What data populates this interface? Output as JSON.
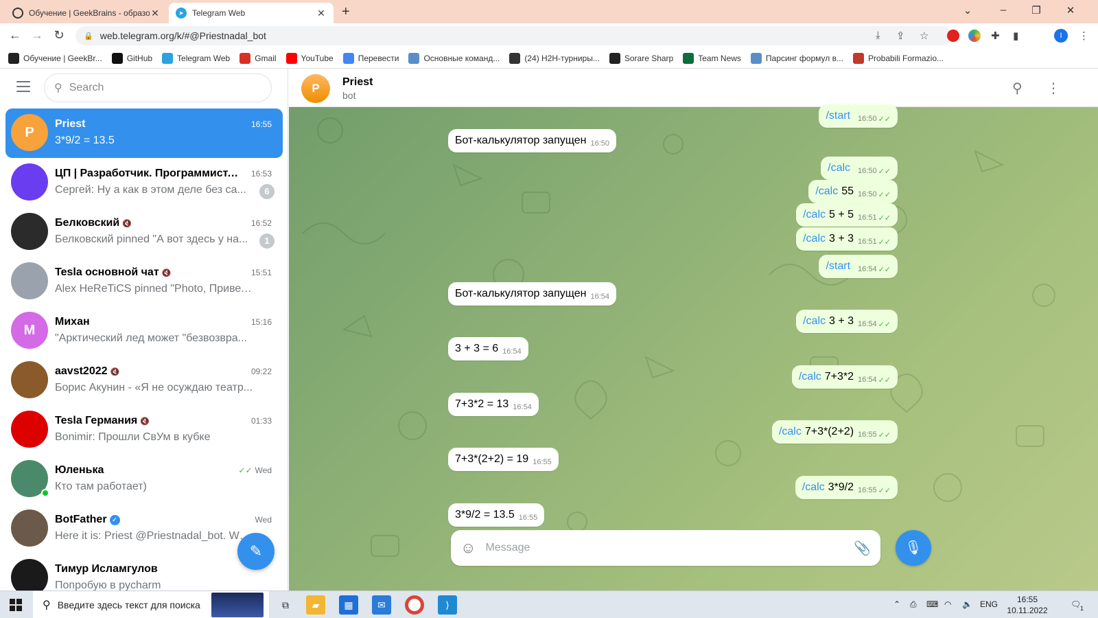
{
  "browser": {
    "tabs": [
      {
        "title": "Обучение | GeekBrains - образо",
        "active": false
      },
      {
        "title": "Telegram Web",
        "active": true
      }
    ],
    "url": "web.telegram.org/k/#@Priestnadal_bot",
    "bookmarks": [
      {
        "label": "Обучение | GeekBr...",
        "icon": "geekbrains-icon",
        "color": "#222222"
      },
      {
        "label": "GitHub",
        "icon": "github-icon",
        "color": "#111111"
      },
      {
        "label": "Telegram Web",
        "icon": "telegram-icon",
        "color": "#2aa3e0"
      },
      {
        "label": "Gmail",
        "icon": "gmail-icon",
        "color": "#d93025"
      },
      {
        "label": "YouTube",
        "icon": "youtube-icon",
        "color": "#ff0000"
      },
      {
        "label": "Перевести",
        "icon": "translate-icon",
        "color": "#4285f4"
      },
      {
        "label": "Основные команд...",
        "icon": "bookmark-icon",
        "color": "#5a8ec8"
      },
      {
        "label": "(24) H2H-турниры...",
        "icon": "bookmark-icon",
        "color": "#333333"
      },
      {
        "label": "Sorare Sharp",
        "icon": "sorare-icon",
        "color": "#222222"
      },
      {
        "label": "Team News",
        "icon": "teamnews-icon",
        "color": "#0b6e3c"
      },
      {
        "label": "Парсинг формул в...",
        "icon": "bookmark-icon",
        "color": "#5a8ec8"
      },
      {
        "label": "Probabili Formazio...",
        "icon": "g-icon",
        "color": "#c0392b"
      }
    ]
  },
  "sidebar": {
    "search_placeholder": "Search",
    "chats": [
      {
        "name": "Priest",
        "time": "16:55",
        "preview": "3*9/2 = 13.5",
        "avatar_letter": "P",
        "avatar_color": "#f7a23a",
        "active": true,
        "badge": "",
        "muted": false
      },
      {
        "name": "ЦП | Разработчик. Программист...",
        "time": "16:53",
        "preview": "Сергей: Ну а как в этом деле без са...",
        "avatar_letter": "",
        "avatar_color": "#6a3df0",
        "active": false,
        "badge": "6",
        "muted": true
      },
      {
        "name": "Белковский",
        "time": "16:52",
        "preview": "Белковский pinned \"А вот здесь у на...",
        "avatar_letter": "",
        "avatar_color": "#2b2b2b",
        "active": false,
        "badge": "1",
        "muted": true
      },
      {
        "name": "Tesla основной чат",
        "time": "15:51",
        "preview": "Alex HeReTiCS pinned \"Photo, Привет! ...",
        "avatar_letter": "",
        "avatar_color": "#9aa3ad",
        "active": false,
        "badge": "",
        "muted": true
      },
      {
        "name": "Михан",
        "time": "15:16",
        "preview": "\"Арктический лед может \"безвозвра...",
        "avatar_letter": "M",
        "avatar_color": "#d46ae6",
        "active": false,
        "badge": "",
        "muted": false
      },
      {
        "name": "aavst2022",
        "time": "09:22",
        "preview": "Борис Акунин - «Я не осуждаю театр...",
        "avatar_letter": "",
        "avatar_color": "#8a5a2b",
        "active": false,
        "badge": "",
        "muted": true
      },
      {
        "name": "Tesla Германия",
        "time": "01:33",
        "preview": "Bonimir: Прошли СвУм в кубке",
        "avatar_letter": "",
        "avatar_color": "#dd0000",
        "active": false,
        "badge": "",
        "muted": true
      },
      {
        "name": "Юленька",
        "time": "Wed",
        "preview": "Кто там работает)",
        "avatar_letter": "",
        "avatar_color": "#4a8a6a",
        "active": false,
        "badge": "",
        "muted": false,
        "read": true,
        "online": true
      },
      {
        "name": "BotFather",
        "time": "Wed",
        "preview": "Here it is: Priest @Priestnadal_bot. What d...",
        "avatar_letter": "",
        "avatar_color": "#6b5a4a",
        "active": false,
        "badge": "",
        "muted": false,
        "verified": true
      },
      {
        "name": "Тимур Исламгулов",
        "time": "",
        "preview": "Попробую в pycharm",
        "avatar_letter": "",
        "avatar_color": "#1a1a1a",
        "active": false,
        "badge": "",
        "muted": false
      }
    ]
  },
  "chat": {
    "title": "Priest",
    "status": "bot",
    "avatar_letter": "P",
    "composer_placeholder": "Message",
    "messages": [
      {
        "dir": "out",
        "cmd": "/start",
        "text": "",
        "time": "16:50"
      },
      {
        "dir": "in",
        "cmd": "",
        "text": "Бот-калькулятор запущен",
        "time": "16:50"
      },
      {
        "dir": "out",
        "cmd": "/calc",
        "text": "",
        "time": "16:50"
      },
      {
        "dir": "out",
        "cmd": "/calc",
        "text": "55",
        "time": "16:50"
      },
      {
        "dir": "out",
        "cmd": "/calc",
        "text": "5 + 5",
        "time": "16:51"
      },
      {
        "dir": "out",
        "cmd": "/calc",
        "text": "3 + 3",
        "time": "16:51"
      },
      {
        "dir": "out",
        "cmd": "/start",
        "text": "",
        "time": "16:54"
      },
      {
        "dir": "in",
        "cmd": "",
        "text": "Бот-калькулятор запущен",
        "time": "16:54"
      },
      {
        "dir": "out",
        "cmd": "/calc",
        "text": "3 + 3",
        "time": "16:54"
      },
      {
        "dir": "in",
        "cmd": "",
        "text": "3 + 3 = 6",
        "time": "16:54"
      },
      {
        "dir": "out",
        "cmd": "/calc",
        "text": "7+3*2",
        "time": "16:54"
      },
      {
        "dir": "in",
        "cmd": "",
        "text": "7+3*2 = 13",
        "time": "16:54"
      },
      {
        "dir": "out",
        "cmd": "/calc",
        "text": "7+3*(2+2)",
        "time": "16:55"
      },
      {
        "dir": "in",
        "cmd": "",
        "text": "7+3*(2+2) = 19",
        "time": "16:55"
      },
      {
        "dir": "out",
        "cmd": "/calc",
        "text": "3*9/2",
        "time": "16:55"
      },
      {
        "dir": "in",
        "cmd": "",
        "text": "3*9/2 = 13.5",
        "time": "16:55"
      }
    ]
  },
  "taskbar": {
    "search_placeholder": "Введите здесь текст для поиска",
    "language": "ENG",
    "time": "16:55",
    "date": "10.11.2022",
    "notification_count": "1"
  }
}
